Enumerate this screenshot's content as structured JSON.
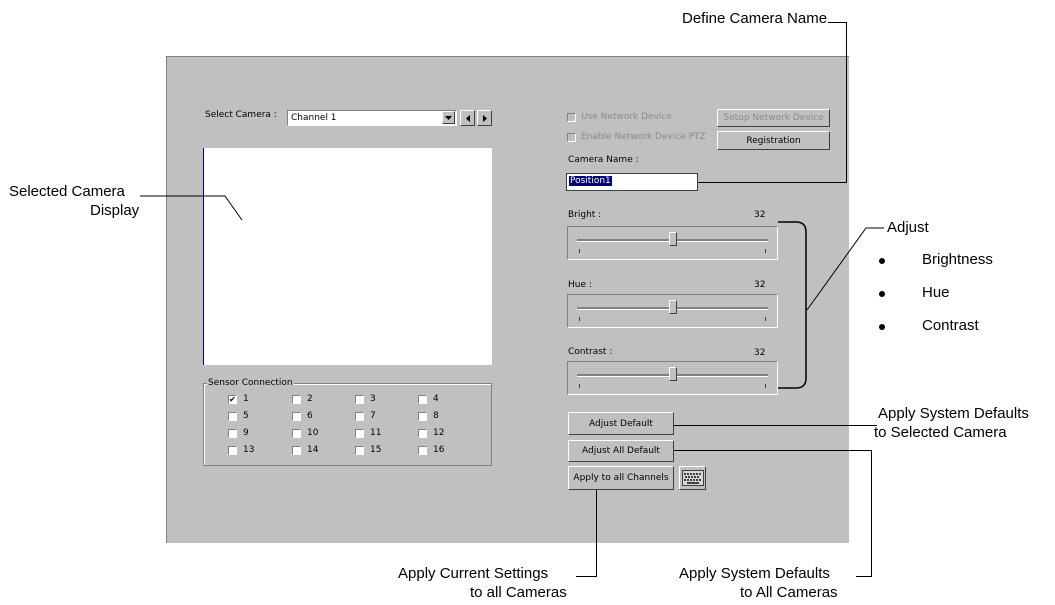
{
  "dialog": {
    "select_camera_label": "Select Camera :",
    "select_camera_value": "Channel 1",
    "use_network_device_label": "Use Network Device",
    "enable_ptz_label": "Enable Network Device PTZ",
    "setup_network_button": "Setup Network Device",
    "registration_button": "Registration",
    "camera_name_label": "Camera Name :",
    "camera_name_value": "Position1",
    "bright_label": "Bright :",
    "bright_value": "32",
    "hue_label": "Hue :",
    "hue_value": "32",
    "contrast_label": "Contrast :",
    "contrast_value": "32",
    "sensor_group_label": "Sensor Connection",
    "sensors": [
      {
        "label": "1",
        "checked": true
      },
      {
        "label": "2",
        "checked": false
      },
      {
        "label": "3",
        "checked": false
      },
      {
        "label": "4",
        "checked": false
      },
      {
        "label": "5",
        "checked": false
      },
      {
        "label": "6",
        "checked": false
      },
      {
        "label": "7",
        "checked": false
      },
      {
        "label": "8",
        "checked": false
      },
      {
        "label": "9",
        "checked": false
      },
      {
        "label": "10",
        "checked": false
      },
      {
        "label": "11",
        "checked": false
      },
      {
        "label": "12",
        "checked": false
      },
      {
        "label": "13",
        "checked": false
      },
      {
        "label": "14",
        "checked": false
      },
      {
        "label": "15",
        "checked": false
      },
      {
        "label": "16",
        "checked": false
      }
    ],
    "adjust_default_button": "Adjust Default",
    "adjust_all_default_button": "Adjust All Default",
    "apply_all_channels_button": "Apply to all Channels",
    "keyboard_icon": "keyboard-icon",
    "slider_level_fraction": 0.5
  },
  "annotations": {
    "define_camera_name": "Define Camera Name",
    "selected_display_1": "Selected Camera",
    "selected_display_2": "Display",
    "adjust": "Adjust",
    "adjust_items": [
      "Brightness",
      "Hue",
      "Contrast"
    ],
    "apply_defaults_selected_1": "Apply System Defaults",
    "apply_defaults_selected_2": "to Selected Camera",
    "apply_current_1": "Apply Current Settings",
    "apply_current_2": "to all Cameras",
    "apply_defaults_all_1": "Apply System Defaults",
    "apply_defaults_all_2": "to All Cameras"
  }
}
